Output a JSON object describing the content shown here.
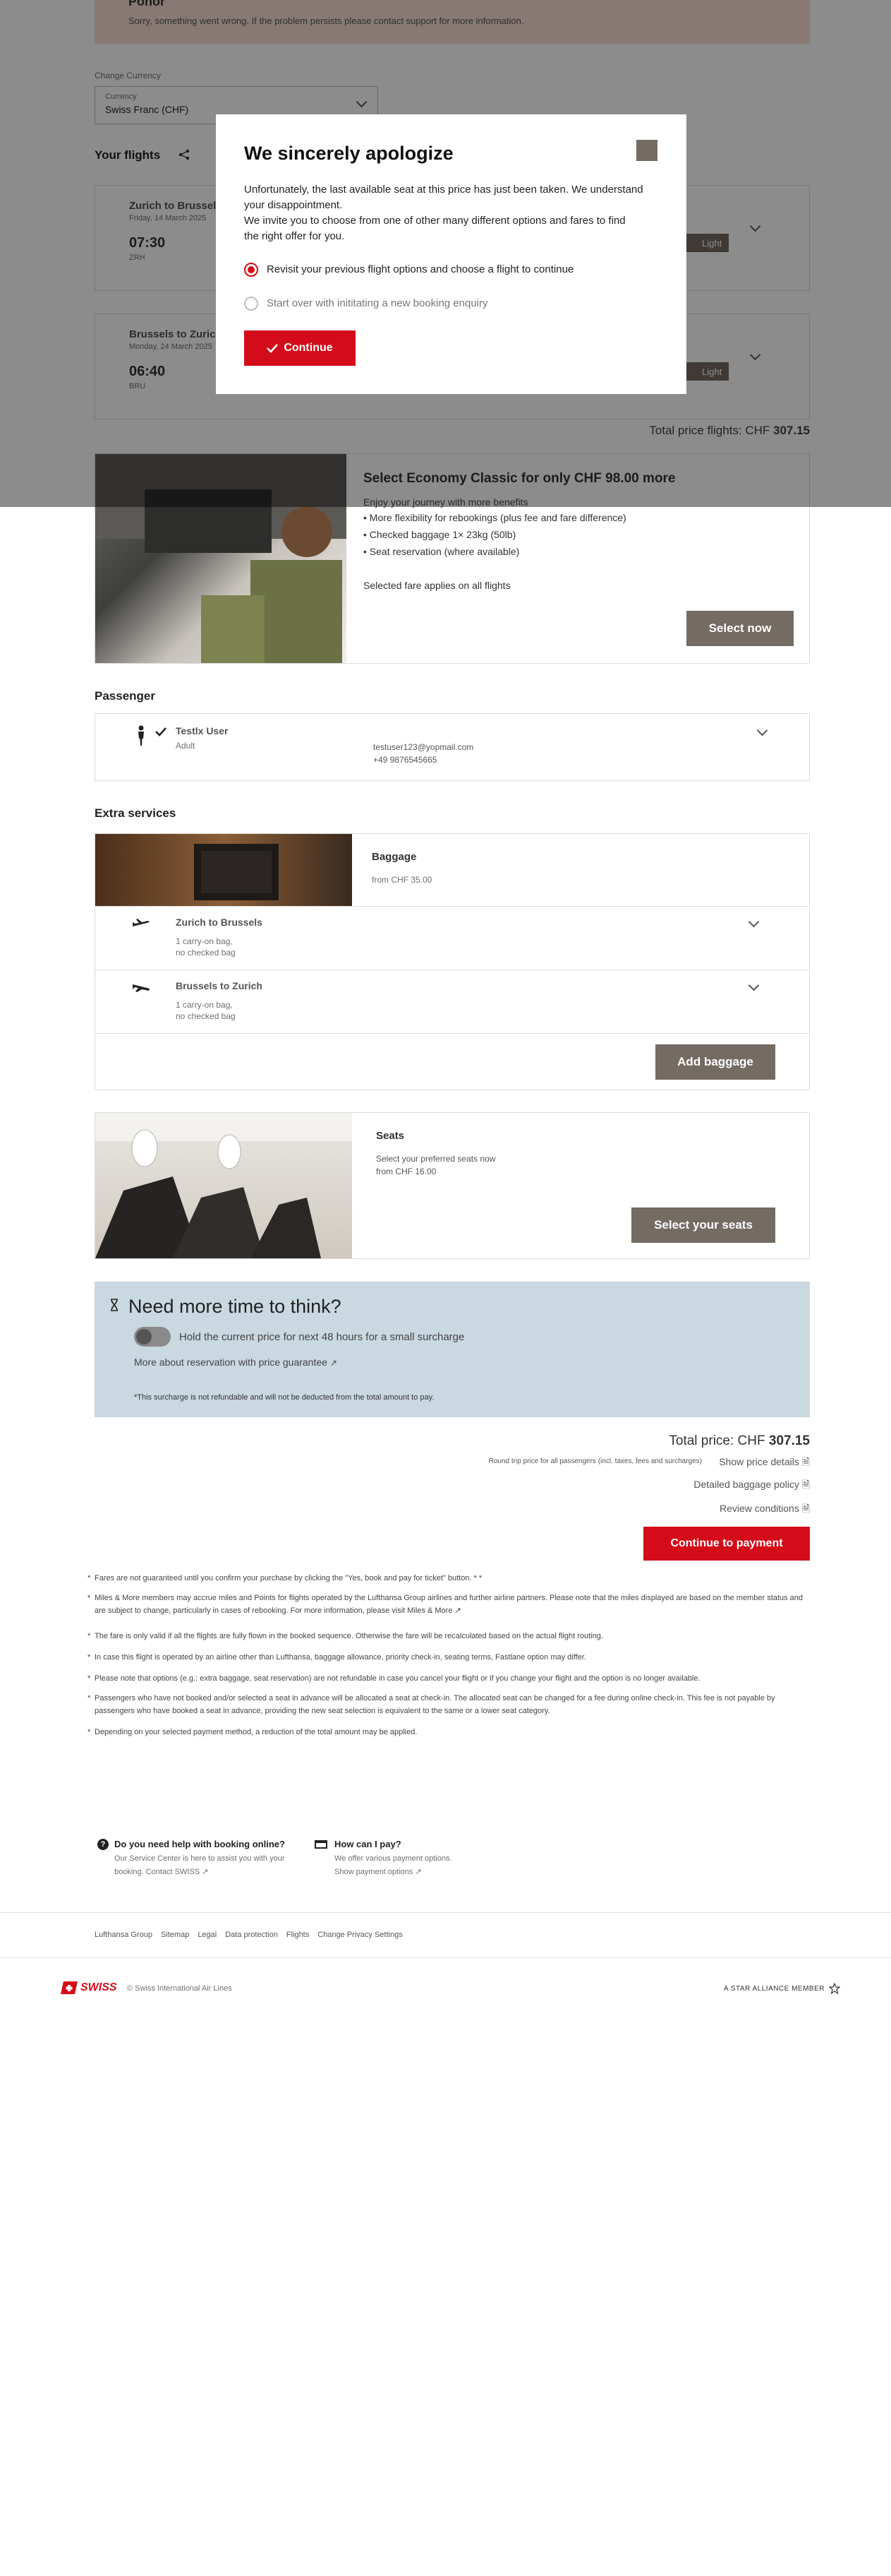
{
  "error_banner": {
    "title": "Pohor",
    "text": "Sorry, something went wrong. If the problem persists please contact support for more information."
  },
  "currency": {
    "label": "Change Currency",
    "field_label": "Currency",
    "value": "Swiss Franc (CHF)"
  },
  "flights": {
    "title": "Your flights",
    "items": [
      {
        "route": "Zurich to Brussels",
        "date": "Friday, 14 March 2025",
        "time": "07:30",
        "code": "ZRH",
        "fare": "Light"
      },
      {
        "route": "Brussels to Zurich",
        "date": "Monday, 24 March 2025",
        "time": "06:40",
        "code": "BRU",
        "fare": "Light"
      }
    ],
    "total_label": "Total price flights: CHF",
    "total_value": "307.15"
  },
  "modal": {
    "title": "We sincerely apologize",
    "paragraph1": "Unfortunately, the last available seat at this price has just been taken. We understand your disappointment.",
    "paragraph2": "We invite you to choose from one of other many different options and fares to find the right offer for you.",
    "option1": "Revisit your previous flight options and choose a flight to continue",
    "option2": "Start over with inititating a new booking enquiry",
    "continue_label": "Continue"
  },
  "upsell": {
    "title": "Select Economy Classic for only CHF 98.00 more",
    "subtitle": "Enjoy your journey with more benefits",
    "benefits": [
      "More flexibility for rebookings (plus fee and fare difference)",
      "Checked baggage 1× 23kg (50lb)",
      "Seat reservation (where available)"
    ],
    "note": "Selected fare applies on all flights",
    "button": "Select now"
  },
  "passenger": {
    "section_title": "Passenger",
    "name": "Testlx User",
    "type": "Adult",
    "email": "testuser123@yopmail.com",
    "phone": "+49 9876545665"
  },
  "extras": {
    "section_title": "Extra services",
    "baggage": {
      "title": "Baggage",
      "price": "from CHF 35.00",
      "legs": [
        {
          "route": "Zurich to Brussels",
          "line1": "1 carry-on bag,",
          "line2": "no checked bag"
        },
        {
          "route": "Brussels to Zurich",
          "line1": "1 carry-on bag,",
          "line2": "no checked bag"
        }
      ],
      "button": "Add baggage"
    },
    "seats": {
      "title": "Seats",
      "line1": "Select your preferred seats now",
      "line2": "from CHF 16.00",
      "button": "Select your seats"
    }
  },
  "hold": {
    "title": "Need more time to think?",
    "toggle_label": "Hold the current price for next 48 hours for a small surcharge",
    "link": "More about reservation with price guarantee",
    "note": "*This surcharge is not refundable and will not be deducted from the total amount to pay."
  },
  "summary": {
    "total_label": "Total price: CHF",
    "total_value": "307.15",
    "round_trip_note": "Round trip price for all passengers (incl. taxes, fees and surcharges)",
    "price_details": "Show price details",
    "baggage_policy": "Detailed baggage policy",
    "review_conditions": "Review conditions",
    "continue_button": "Continue to payment"
  },
  "notes": [
    "Fares are not guaranteed until you confirm your purchase by clicking the \"Yes, book and pay for ticket\" button. * *",
    "Miles & More members may accrue miles and Points for flights operated by the Lufthansa Group airlines and further airline partners. Please note that the miles displayed are based on the member status and are subject to change, particularly in cases of rebooking. For more information, please visit Miles & More",
    "The fare is only valid if all the flights are fully flown in the booked sequence. Otherwise the fare will be recalculated based on the actual flight routing.",
    "In case this flight is operated by an airline other than Lufthansa, baggage allowance, priority check-in, seating terms, Fastlane option may differ.",
    "Please note that options (e.g.: extra baggage, seat reservation) are not refundable in case you cancel your flight or if you change your flight and the option is no longer available.",
    "Passengers who have not booked and/or selected a seat in advance will be allocated a seat at check-in. The allocated seat can be changed for a fee during online check-in. This fee is not payable by passengers who have booked a seat in advance, providing the new seat selection is equivalent to the same or a lower seat category.",
    "Depending on your selected payment method, a reduction of the total amount may be applied."
  ],
  "help": {
    "q1_title": "Do you need help with booking online?",
    "q1_text1": "Our Service Center is here to assist you with your",
    "q1_text2": "booking. Contact SWISS",
    "q2_title": "How can I pay?",
    "q2_text1": "We offer various payment options.",
    "q2_text2": "Show payment options"
  },
  "footer": {
    "links": [
      "Lufthansa Group",
      "Sitemap",
      "Legal",
      "Data protection",
      "Flights",
      "Change Privacy Settings"
    ],
    "brand": "SWISS",
    "copyright": "© Swiss International Air Lines",
    "alliance": "A STAR ALLIANCE MEMBER"
  },
  "colors": {
    "brand_red": "#d40c19",
    "button_brown": "#746b62",
    "hold_bg": "#c9d8e1"
  }
}
